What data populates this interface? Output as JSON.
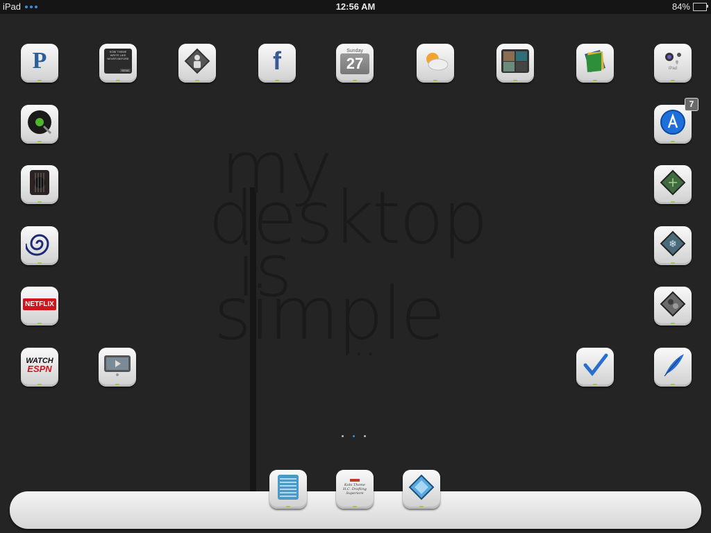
{
  "status_bar": {
    "device": "iPad",
    "time": "12:56 AM",
    "battery": "84%",
    "battery_level": 0.84
  },
  "wallpaper": {
    "line1": "my",
    "line2": "desktop",
    "line3": "is",
    "line4": "simple",
    "line5": "..."
  },
  "home_icons": {
    "pandora": {
      "label": "P",
      "icon": "pandora-icon"
    },
    "write_app": {
      "line1": "KOBI THEME",
      "line2": "WRITE LIKE",
      "line3": "NEVER BEFORE",
      "send": "SEND",
      "icon": "note-icon"
    },
    "contacts": {
      "icon": "person-sign-icon"
    },
    "facebook": {
      "label": "f",
      "icon": "facebook-icon"
    },
    "calendar": {
      "day": "Sunday",
      "date": "27",
      "icon": "calendar-icon"
    },
    "weather": {
      "icon": "weather-sun-cloud-icon"
    },
    "photo_booth": {
      "icon": "photo-booth-icon"
    },
    "photos_stack": {
      "icon": "photos-stack-icon"
    },
    "ipad_settings": {
      "label": "iPad",
      "icon": "camera-ipad-icon"
    },
    "music": {
      "icon": "vinyl-record-icon"
    },
    "guitar": {
      "icon": "guitar-icon"
    },
    "time_warner": {
      "icon": "time-warner-icon"
    },
    "netflix": {
      "label": "NETFLIX",
      "icon": "netflix-icon"
    },
    "watch_espn": {
      "label1": "WATCH",
      "label2": "ESPN",
      "icon": "espn-icon"
    },
    "video": {
      "icon": "tv-play-icon"
    },
    "app_store": {
      "badge": "7",
      "icon": "app-store-icon"
    },
    "circuit": {
      "icon": "circuit-diamond-icon"
    },
    "snowflake": {
      "icon": "snowflake-diamond-icon"
    },
    "camo": {
      "icon": "camo-diamond-icon"
    },
    "tasks": {
      "icon": "checkmark-icon"
    },
    "quill": {
      "icon": "quill-icon"
    }
  },
  "dock_icons": {
    "notes_lines": {
      "icon": "lined-list-icon"
    },
    "notes_handwriting": {
      "line1": "Kobi Theme",
      "line2": "H.C. Drafting",
      "line3": "Superiore",
      "icon": "handwriting-note-icon"
    },
    "diamond_app": {
      "icon": "blue-diamond-icon"
    }
  },
  "page_indicator": {
    "pages": 3,
    "current": 2
  },
  "colors": {
    "wallpaper": "#242424",
    "status_bar": "#151515",
    "accent_blue": "#3a8fd9",
    "battery_green": "#6fc04c",
    "netflix_red": "#d1131c",
    "facebook_blue": "#3b5998"
  }
}
